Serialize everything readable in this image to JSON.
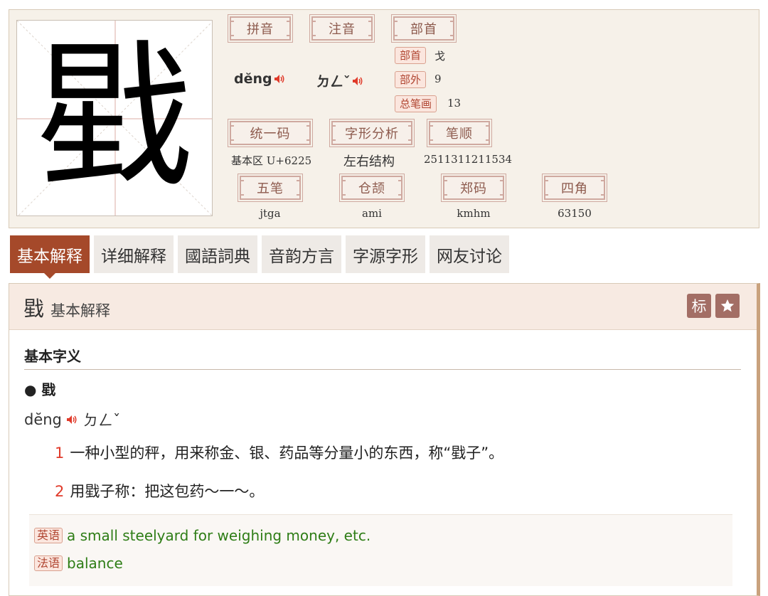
{
  "character": "戥",
  "labels": {
    "pinyin": "拼音",
    "zhuyin": "注音",
    "radical": "部首",
    "unicode": "统一码",
    "structure": "字形分析",
    "stroke_order": "笔顺",
    "wubi": "五笔",
    "cangjie": "仓颉",
    "zhengma": "郑码",
    "four_corner": "四角"
  },
  "values": {
    "pinyin": "dĕng",
    "zhuyin": "ㄉㄥˇ",
    "unicode": "基本区 U+6225",
    "structure": "左右结构",
    "stroke_order": "2511311211534",
    "wubi": "jtga",
    "cangjie": "ami",
    "zhengma": "kmhm",
    "four_corner": "63150"
  },
  "radical_info": [
    {
      "tag": "部首",
      "value": "戈"
    },
    {
      "tag": "部外",
      "value": "9"
    },
    {
      "tag": "总笔画",
      "value": "13"
    }
  ],
  "tabs": [
    "基本解释",
    "详细解释",
    "國語詞典",
    "音韵方言",
    "字源字形",
    "网友讨论"
  ],
  "active_tab": "基本解释",
  "panel": {
    "title_char": "戥",
    "title_sub": "基本解释",
    "mark_button": "标",
    "section_title": "基本字义",
    "bullet": "● 戥",
    "pinyin": "dĕng",
    "zhuyin": "ㄉㄥˇ",
    "definitions": [
      {
        "num": "1",
        "text": "一种小型的秤，用来称金、银、药品等分量小的东西，称“戥子”。"
      },
      {
        "num": "2",
        "text": "用戥子称：把这包药～一～。"
      }
    ],
    "translations": [
      {
        "lang": "英语",
        "text": "a small steelyard for weighing money, etc."
      },
      {
        "lang": "法语",
        "text": "balance"
      }
    ]
  },
  "colors": {
    "accent": "#a5492a",
    "label_text": "#8d5a4d",
    "definition_number": "#e03a2a",
    "translation_text": "#2e7d16",
    "speaker": "#e03a2a"
  },
  "icons": [
    "speaker-icon",
    "star-icon"
  ]
}
